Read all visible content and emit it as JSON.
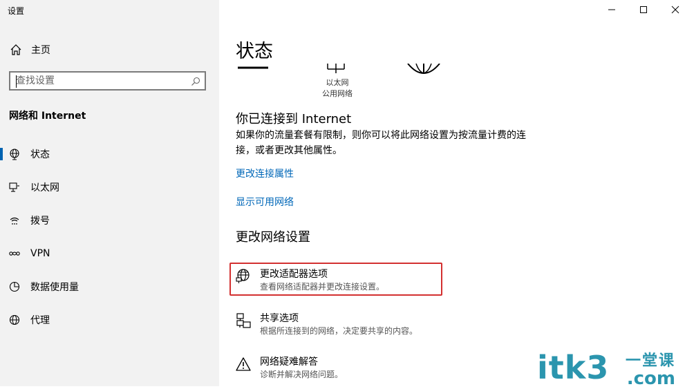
{
  "window": {
    "title": "设置"
  },
  "sidebar": {
    "home_label": "主页",
    "search_placeholder": "查找设置",
    "section_title": "网络和 Internet",
    "items": [
      {
        "label": "状态",
        "icon": "globe-status-icon",
        "active": true
      },
      {
        "label": "以太网",
        "icon": "ethernet-icon",
        "active": false
      },
      {
        "label": "拨号",
        "icon": "dialup-icon",
        "active": false
      },
      {
        "label": "VPN",
        "icon": "vpn-icon",
        "active": false
      },
      {
        "label": "数据使用量",
        "icon": "data-usage-icon",
        "active": false
      },
      {
        "label": "代理",
        "icon": "globe-proxy-icon",
        "active": false
      }
    ]
  },
  "main": {
    "title": "状态",
    "network": {
      "name": "以太网",
      "type": "公用网络"
    },
    "connected_heading": "你已连接到 Internet",
    "connected_desc": "如果你的流量套餐有限制，则你可以将此网络设置为按流量计费的连接，或者更改其他属性。",
    "links": {
      "change_props": "更改连接属性",
      "show_networks": "显示可用网络"
    },
    "change_heading": "更改网络设置",
    "options": [
      {
        "title": "更改适配器选项",
        "desc": "查看网络适配器并更改连接设置。",
        "icon": "adapter-globe-icon"
      },
      {
        "title": "共享选项",
        "desc": "根据所连接到的网络，决定要共享的内容。",
        "icon": "sharing-icon"
      },
      {
        "title": "网络疑难解答",
        "desc": "诊断并解决网络问题。",
        "icon": "warning-icon"
      }
    ]
  },
  "watermark": {
    "main": "itk3",
    "line1": "一堂课",
    "line2": ".com"
  },
  "colors": {
    "sidebar_bg": "#f2f2f2",
    "link": "#0067b8",
    "accent": "#0063b1",
    "highlight_border": "#d32f2f",
    "watermark": "#2b95ae"
  }
}
